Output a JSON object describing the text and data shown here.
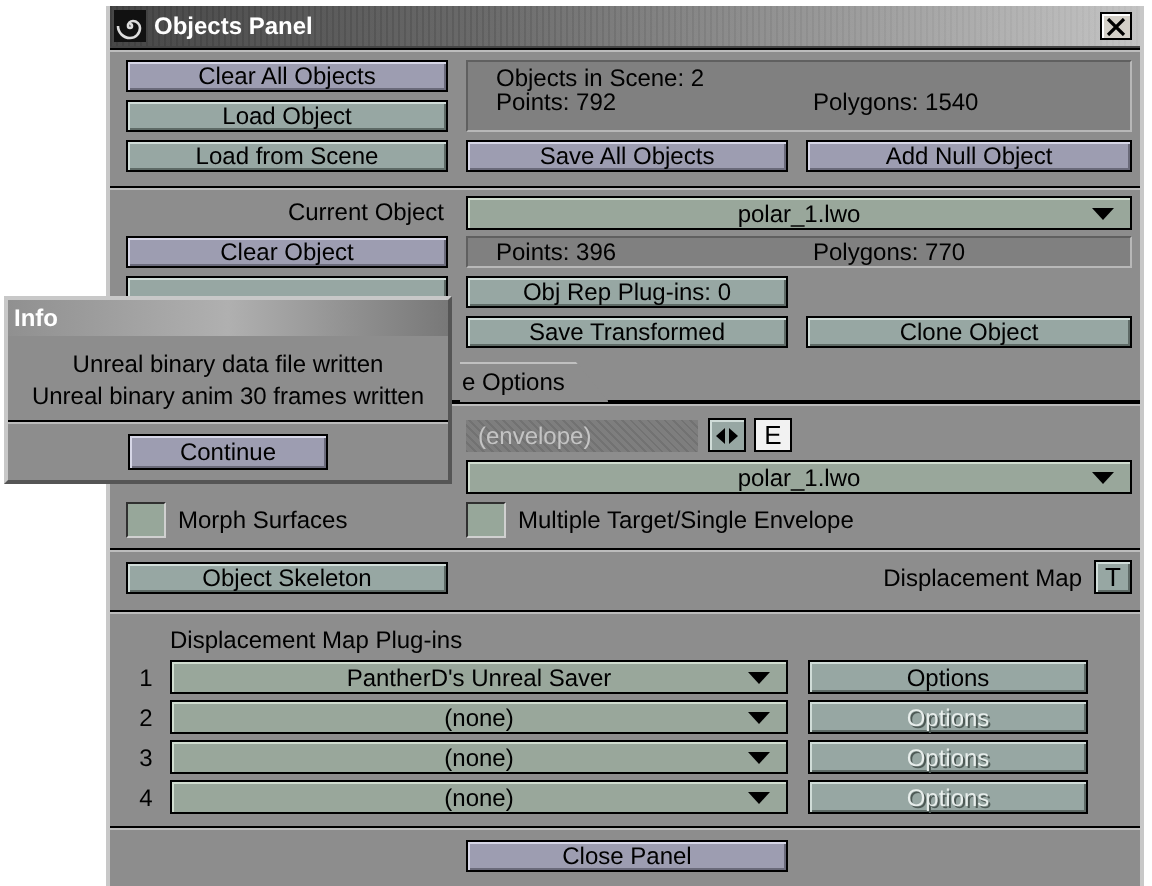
{
  "window": {
    "title": "Objects Panel"
  },
  "scene": {
    "buttons": [
      "Clear All Objects",
      "Load Object",
      "Load from Scene"
    ],
    "info": {
      "objects": "Objects in Scene: 2",
      "points": "Points: 792",
      "polygons": "Polygons: 1540"
    },
    "actions": [
      "Save All Objects",
      "Add Null Object"
    ]
  },
  "object": {
    "current_label": "Current Object",
    "current_value": "polar_1.lwo",
    "clear": "Clear Object",
    "points": "Points: 396",
    "polygons": "Polygons: 770",
    "plugins": "Obj Rep Plug-ins: 0",
    "save_transformed": "Save Transformed",
    "clone": "Clone Object"
  },
  "tabs": [
    {
      "label": "e Options",
      "selected": true
    }
  ],
  "morph": {
    "envelope": {
      "value": "(envelope)",
      "disabled": true
    },
    "e_button": "E",
    "target": "polar_1.lwo",
    "checkboxes": [
      {
        "label": "Morph Surfaces",
        "checked": false
      },
      {
        "label": "Multiple Target/Single Envelope",
        "checked": false
      }
    ]
  },
  "skeleton": {
    "button": "Object Skeleton",
    "displacement_label": "Displacement Map",
    "t_button": "T"
  },
  "plugins": {
    "title": "Displacement Map Plug-ins",
    "rows": [
      {
        "index": "1",
        "value": "PantherD's Unreal Saver",
        "options": "Options",
        "disabled": false
      },
      {
        "index": "2",
        "value": "(none)",
        "options": "Options",
        "disabled": true
      },
      {
        "index": "3",
        "value": "(none)",
        "options": "Options",
        "disabled": true
      },
      {
        "index": "4",
        "value": "(none)",
        "options": "Options",
        "disabled": true
      }
    ]
  },
  "close": "Close Panel",
  "dialog": {
    "title": "Info",
    "lines": [
      "Unreal binary data file written",
      "Unreal binary anim 30 frames written"
    ],
    "button": "Continue"
  }
}
